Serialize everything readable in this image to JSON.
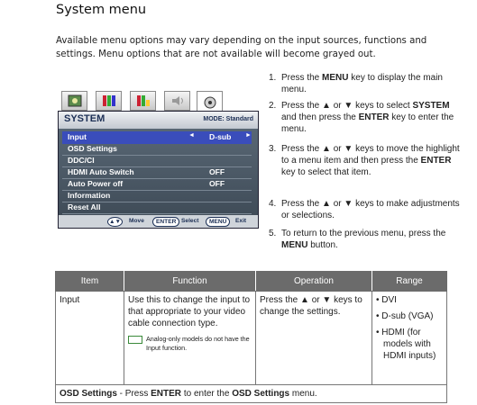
{
  "page": {
    "title": "System menu",
    "intro": "Available menu options may vary depending on the input sources, functions and settings. Menu options that are not available will become grayed out."
  },
  "osd": {
    "title": "SYSTEM",
    "mode": "MODE: Standard",
    "tab_icons": [
      "picture-icon",
      "color-icon",
      "picture-advanced-icon",
      "audio-icon",
      "system-icon"
    ],
    "items": [
      {
        "label": "Input",
        "value": "D-sub",
        "selected": true
      },
      {
        "label": "OSD Settings",
        "value": ""
      },
      {
        "label": "DDC/CI",
        "value": ""
      },
      {
        "label": "HDMI Auto Switch",
        "value": "OFF"
      },
      {
        "label": "Auto Power off",
        "value": "OFF"
      },
      {
        "label": "Information",
        "value": ""
      },
      {
        "label": "Reset All",
        "value": ""
      }
    ],
    "footer": {
      "move": "Move",
      "enter_key": "ENTER",
      "select": "Select",
      "menu_key": "MENU",
      "exit": "Exit"
    }
  },
  "steps": [
    {
      "num": "1.",
      "pre": "Press the ",
      "key": "MENU",
      "post": " key to display the main menu."
    },
    {
      "num": "2.",
      "pre": "Press the ",
      "mid1": " or ",
      "mid2": " keys to select ",
      "key": "SYSTEM",
      "post_pre": " and then press the ",
      "key2": "ENTER",
      "post": " key to enter the menu."
    },
    {
      "num": "3.",
      "pre": "Press the ",
      "mid1": " or ",
      "mid2": " keys to move the highlight to a menu item and then press the ",
      "key": "ENTER",
      "post": " key to select that item."
    },
    {
      "num": "4.",
      "pre": "Press the ",
      "mid1": " or ",
      "post": " keys to make adjustments or selections."
    },
    {
      "num": "5.",
      "pre": "To return to the previous menu, press the ",
      "key": "MENU",
      "post": " button."
    }
  ],
  "table": {
    "headers": [
      "Item",
      "Function",
      "Operation",
      "Range"
    ],
    "row": {
      "item": "Input",
      "function": "Use this to change the input to that appropriate to your video cable connection type.",
      "note": "Analog-only models do not have the Input function.",
      "operation_pre": "Press the ",
      "operation_or": " or ",
      "operation_post": " keys to change the settings.",
      "range": [
        "DVI",
        "D-sub (VGA)",
        "HDMI (for models with HDMI inputs)"
      ]
    },
    "footer_row": {
      "label": "OSD Settings",
      "pre": " - Press ",
      "key": "ENTER",
      "mid": " to enter the ",
      "target": "OSD Settings",
      "post": " menu."
    }
  }
}
